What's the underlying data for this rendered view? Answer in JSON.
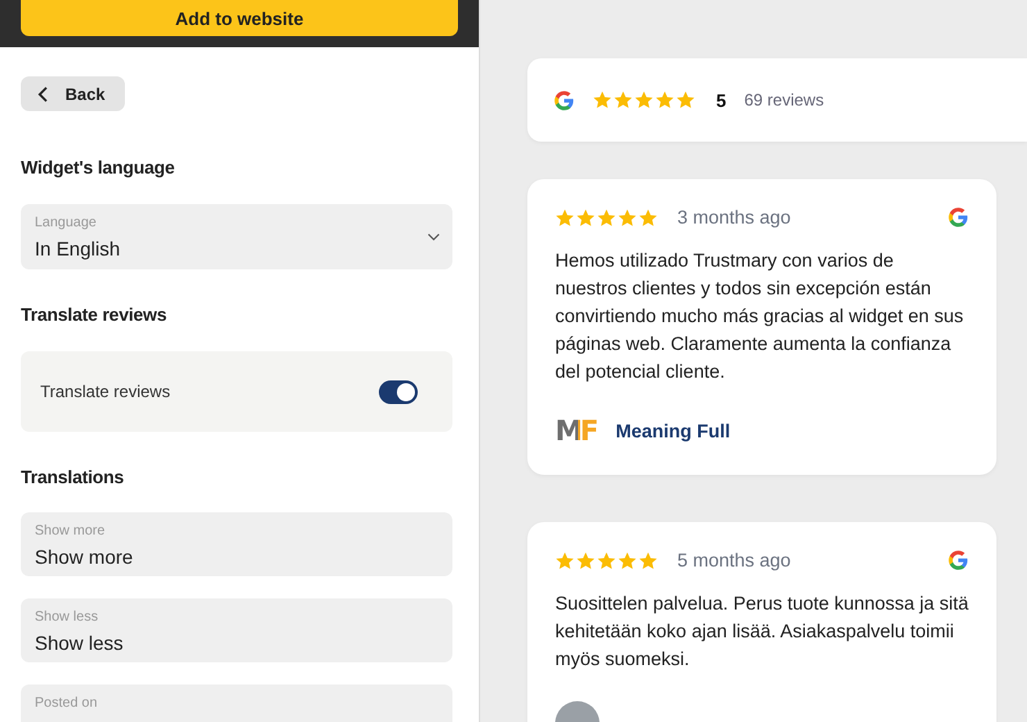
{
  "header": {
    "button": "Add to website"
  },
  "back_button": "Back",
  "sections": [
    {
      "heading": "Widget's language",
      "kind": "select",
      "label": "Language",
      "value": "In English"
    },
    {
      "heading": "Translate reviews",
      "kind": "toggle",
      "label": "Translate reviews",
      "on": true
    },
    {
      "heading": "Translations",
      "kind": "fields",
      "fields": [
        {
          "label": "Show more",
          "value": "Show more"
        },
        {
          "label": "Show less",
          "value": "Show less"
        },
        {
          "label": "Posted on"
        }
      ]
    }
  ],
  "summary": {
    "stars": 5,
    "rating": "5",
    "count": "69 reviews"
  },
  "reviews": [
    {
      "stars": 5,
      "time": "3 months ago",
      "text": "Hemos utilizado Trustmary con varios de nuestros clientes y todos sin excepción están convirtiendo mucho más gracias al widget en sus páginas web. Claramente aumenta la confianza del potencial cliente.",
      "author_logo": "MF",
      "author": "Meaning Full"
    },
    {
      "stars": 5,
      "time": "5 months ago",
      "text": "Suosittelen palvelua. Perus tuote kunnossa ja sitä kehitetään koko ajan lisää. Asiakaspalvelu toimii myös suomeksi."
    }
  ]
}
